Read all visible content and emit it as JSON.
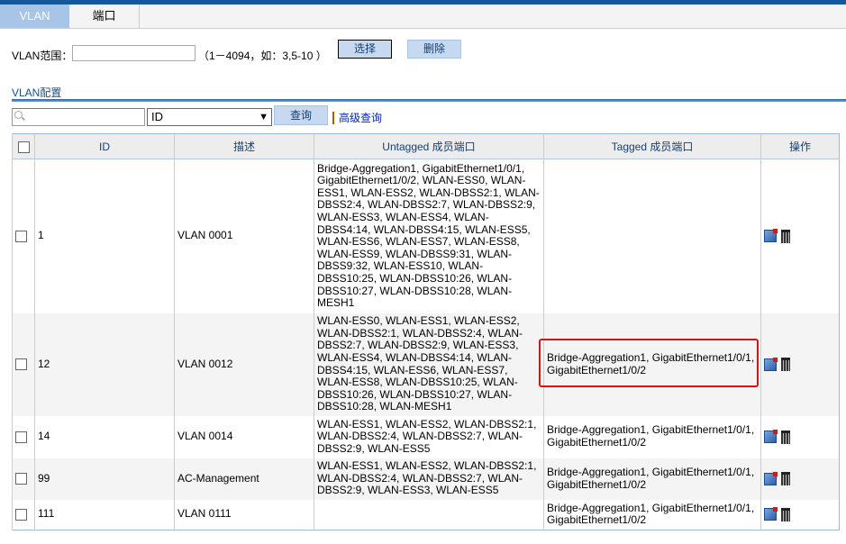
{
  "tabs": [
    {
      "label": "VLAN"
    },
    {
      "label": "端口"
    }
  ],
  "range": {
    "label": "VLAN范围：",
    "value": "",
    "hint": "（1－4094，如：3,5-10 ）",
    "select_label": "选择",
    "delete_label": "删除"
  },
  "section_title": "VLAN配置",
  "search": {
    "value": "",
    "field": "ID",
    "query_label": "查询",
    "advanced_label": "高级查询"
  },
  "table": {
    "headers": [
      "ID",
      "描述",
      "Untagged 成员端口",
      "Tagged 成员端口",
      "操作"
    ],
    "rows": [
      {
        "id": "1",
        "desc": "VLAN 0001",
        "untagged": "Bridge-Aggregation1, GigabitEthernet1/0/1, GigabitEthernet1/0/2, WLAN-ESS0, WLAN-ESS1, WLAN-ESS2, WLAN-DBSS2:1, WLAN-DBSS2:4, WLAN-DBSS2:7, WLAN-DBSS2:9, WLAN-ESS3, WLAN-ESS4, WLAN-DBSS4:14, WLAN-DBSS4:15, WLAN-ESS5, WLAN-ESS6, WLAN-ESS7, WLAN-ESS8, WLAN-ESS9, WLAN-DBSS9:31, WLAN-DBSS9:32, WLAN-ESS10, WLAN-DBSS10:25, WLAN-DBSS10:26, WLAN-DBSS10:27, WLAN-DBSS10:28, WLAN-MESH1",
        "tagged": ""
      },
      {
        "id": "12",
        "desc": "VLAN 0012",
        "untagged": "WLAN-ESS0, WLAN-ESS1, WLAN-ESS2, WLAN-DBSS2:1, WLAN-DBSS2:4, WLAN-DBSS2:7, WLAN-DBSS2:9, WLAN-ESS3, WLAN-ESS4, WLAN-DBSS4:14, WLAN-DBSS4:15, WLAN-ESS6, WLAN-ESS7, WLAN-ESS8, WLAN-DBSS10:25, WLAN-DBSS10:26, WLAN-DBSS10:27, WLAN-DBSS10:28, WLAN-MESH1",
        "tagged": "Bridge-Aggregation1, GigabitEthernet1/0/1, GigabitEthernet1/0/2"
      },
      {
        "id": "14",
        "desc": "VLAN 0014",
        "untagged": "WLAN-ESS1, WLAN-ESS2, WLAN-DBSS2:1, WLAN-DBSS2:4, WLAN-DBSS2:7, WLAN-DBSS2:9, WLAN-ESS5",
        "tagged": "Bridge-Aggregation1, GigabitEthernet1/0/1, GigabitEthernet1/0/2"
      },
      {
        "id": "99",
        "desc": "AC-Management",
        "untagged": "WLAN-ESS1, WLAN-ESS2, WLAN-DBSS2:1, WLAN-DBSS2:4, WLAN-DBSS2:7, WLAN-DBSS2:9, WLAN-ESS3, WLAN-ESS5",
        "tagged": "Bridge-Aggregation1, GigabitEthernet1/0/1, GigabitEthernet1/0/2"
      },
      {
        "id": "111",
        "desc": "VLAN 0111",
        "untagged": "",
        "tagged": "Bridge-Aggregation1, GigabitEthernet1/0/1, GigabitEthernet1/0/2"
      }
    ]
  },
  "colors": {
    "accent": "#14589a",
    "highlight": "#e01010"
  }
}
